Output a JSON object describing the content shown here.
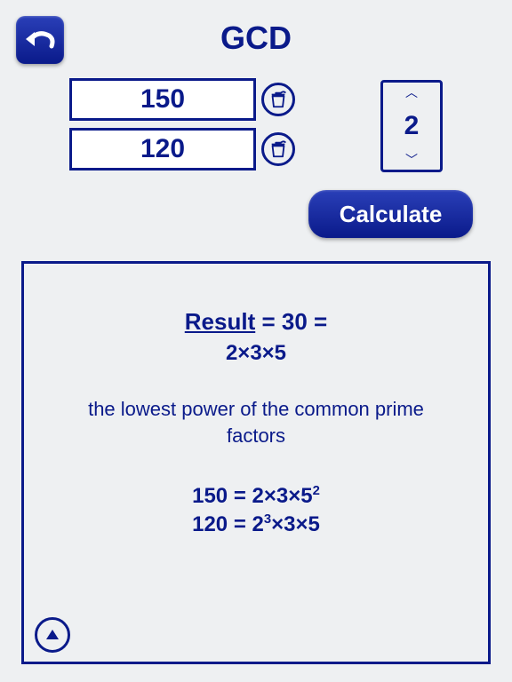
{
  "title": "GCD",
  "inputs": [
    {
      "value": "150"
    },
    {
      "value": "120"
    }
  ],
  "stepper": {
    "value": "2"
  },
  "buttons": {
    "calculate": "Calculate"
  },
  "result": {
    "label": "Result",
    "value": "30",
    "factorization": "2×3×5",
    "explanation": "the lowest power of the common prime factors",
    "rows": [
      {
        "n": "150",
        "f_html": "2×3×5<span class='sup'>2</span>"
      },
      {
        "n": "120",
        "f_html": "2<span class='sup'>3</span>×3×5"
      }
    ]
  }
}
